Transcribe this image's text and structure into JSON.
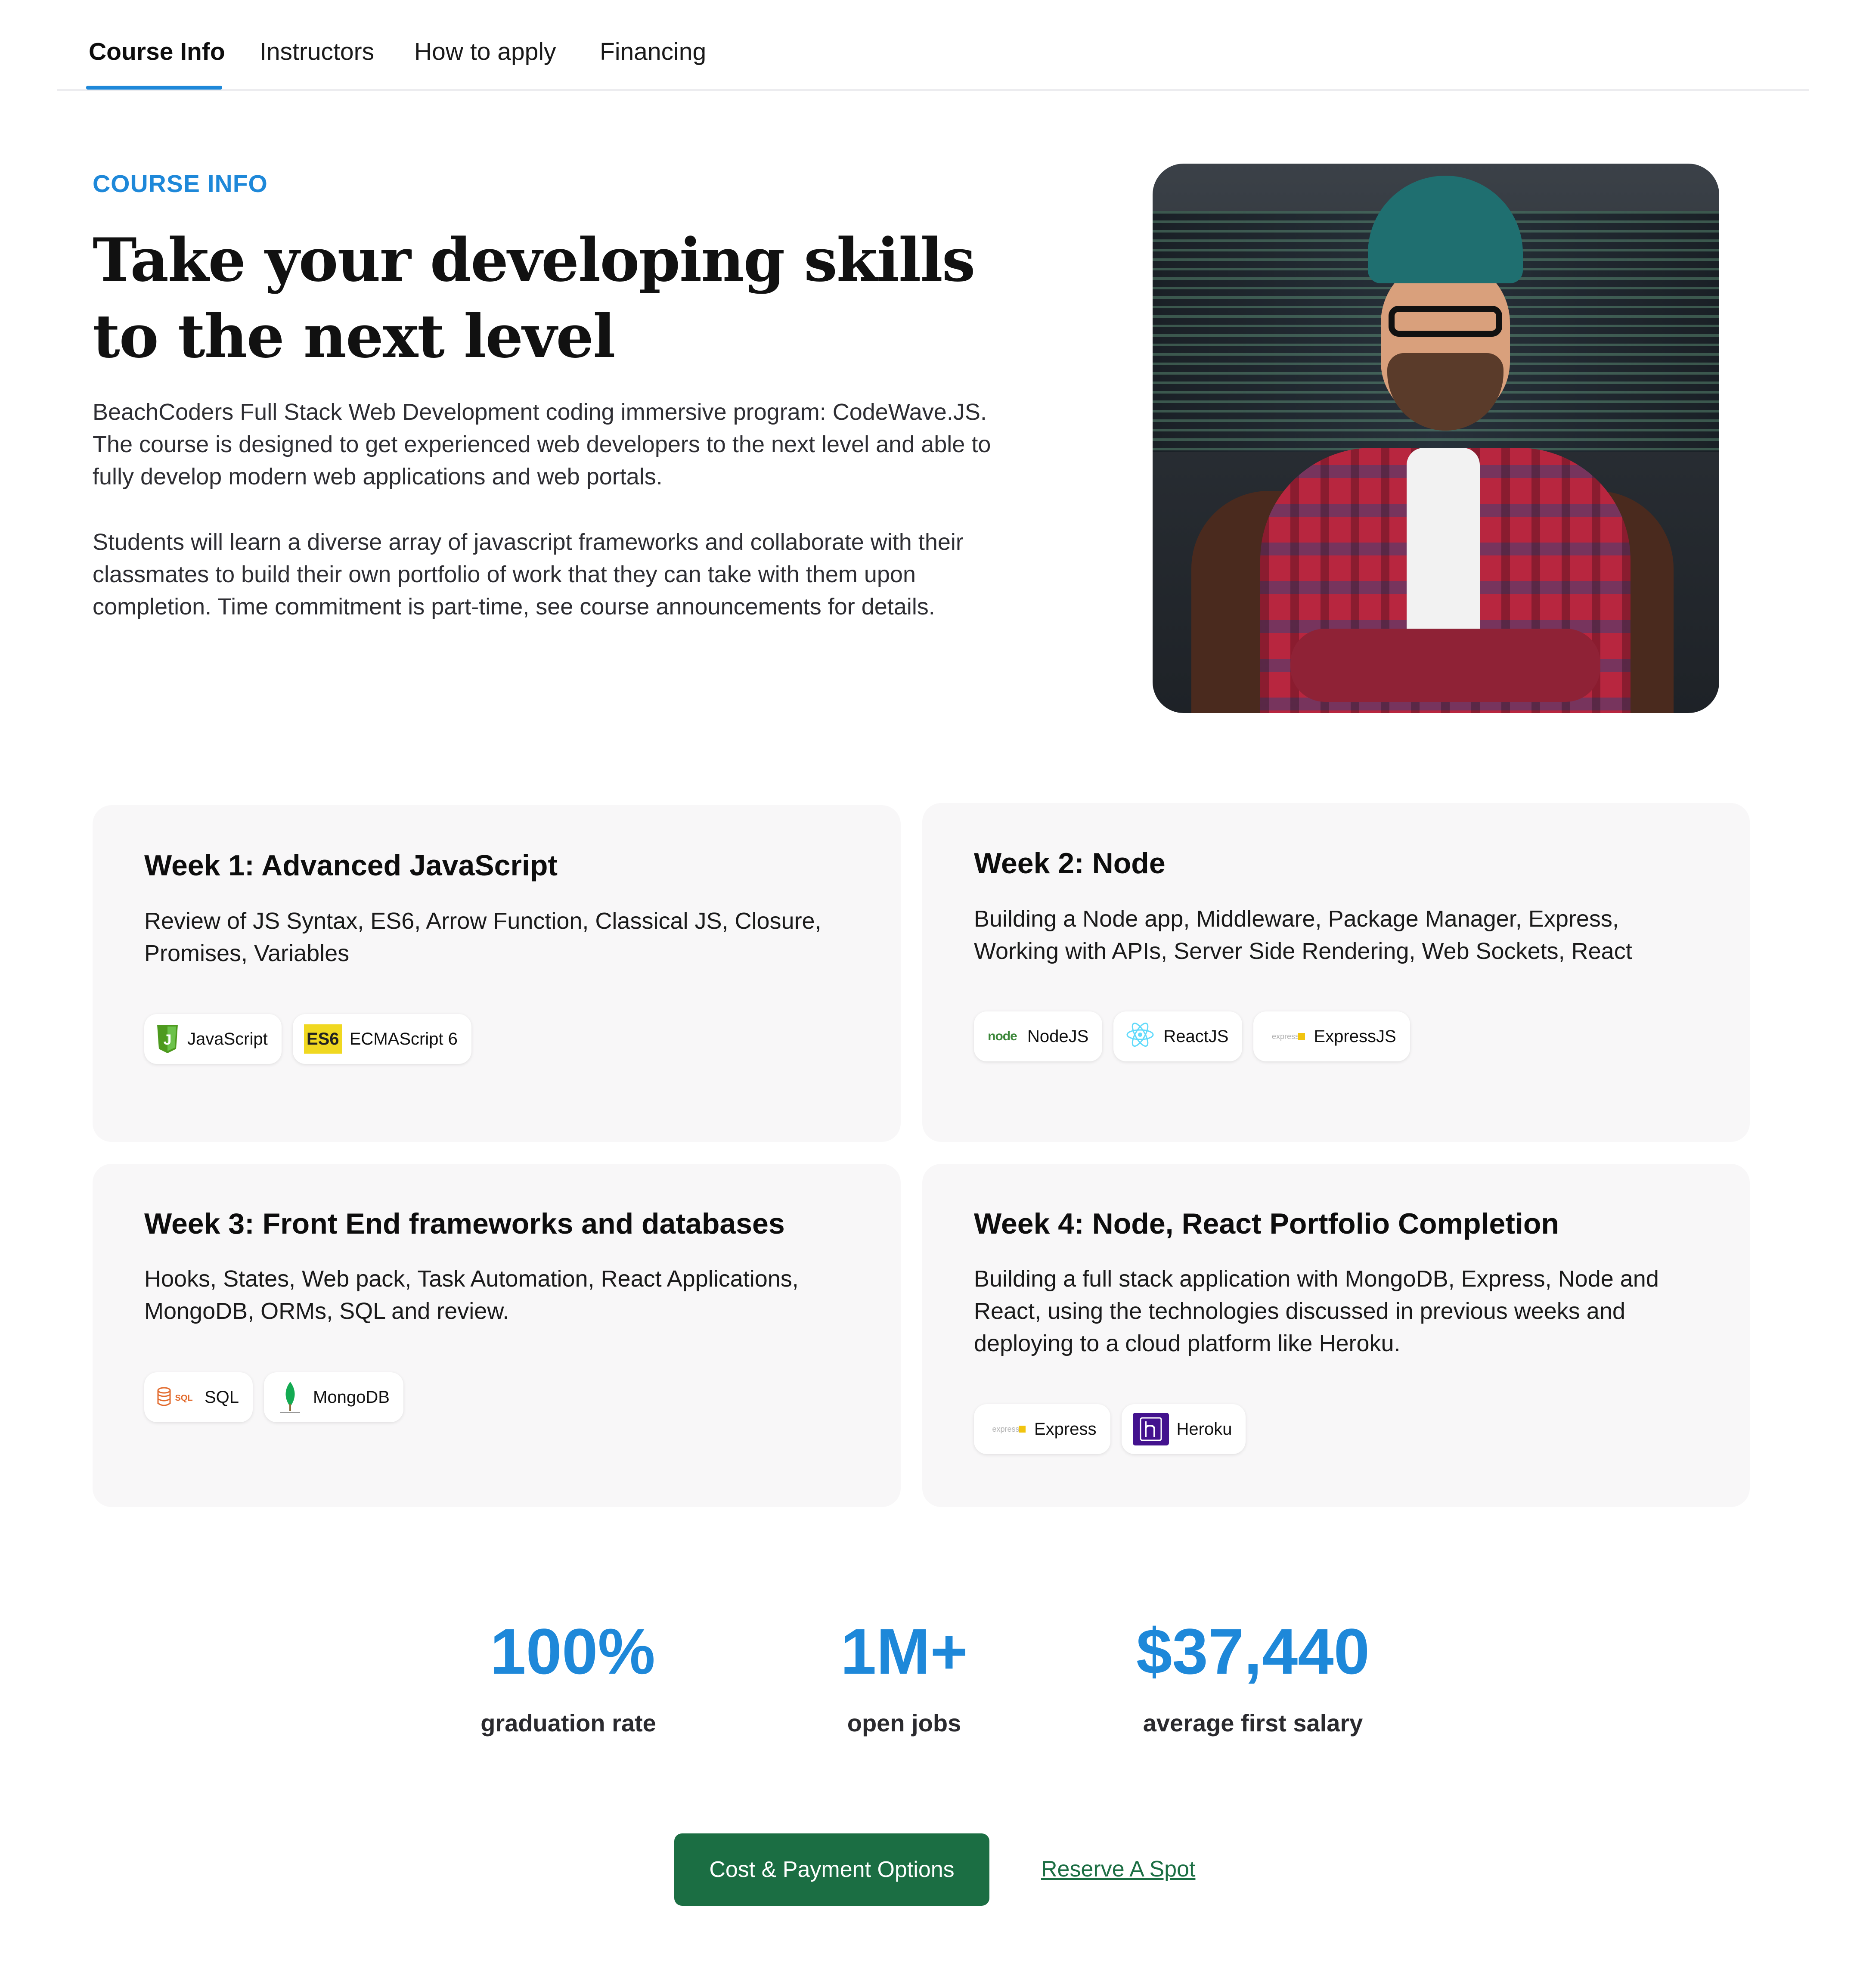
{
  "tabs": [
    {
      "label": "Course Info",
      "active": true
    },
    {
      "label": "Instructors",
      "active": false
    },
    {
      "label": "How to apply",
      "active": false
    },
    {
      "label": "Financing",
      "active": false
    }
  ],
  "hero": {
    "eyebrow": "COURSE INFO",
    "title": "Take your developing skills to the next level",
    "paragraph1": "BeachCoders Full Stack Web Development coding immersive program: CodeWave.JS. The course is designed to get experienced web developers to the next level and able to fully develop modern web applications and web portals.",
    "paragraph2": "Students will learn a diverse array of javascript frameworks and collaborate with their classmates to build their own portfolio of work that they can take with them upon completion. Time commitment is part-time, see course announcements for details.",
    "image_alt": "Smiling developer in beanie and plaid shirt in front of code screens"
  },
  "weeks": [
    {
      "title": "Week 1: Advanced JavaScript",
      "description": "Review of JS Syntax, ES6, Arrow Function, Classical JS, Closure, Promises, Variables",
      "chips": [
        {
          "label": "JavaScript",
          "icon": "javascript-logo-icon"
        },
        {
          "label": "ECMAScript 6",
          "icon": "es6-logo-icon",
          "logo_text": "ES6"
        }
      ]
    },
    {
      "title": "Week 2: Node",
      "description": "Building a Node app, Middleware, Package Manager, Express, Working with APIs, Server Side Rendering, Web Sockets, React",
      "chips": [
        {
          "label": "NodeJS",
          "icon": "nodejs-logo-icon",
          "logo_text": "node"
        },
        {
          "label": "ReactJS",
          "icon": "react-logo-icon"
        },
        {
          "label": "ExpressJS",
          "icon": "express-logo-icon",
          "logo_text": "express"
        }
      ]
    },
    {
      "title": "Week 3: Front End frameworks and databases",
      "description": "Hooks, States, Web pack, Task Automation, React Applications, MongoDB, ORMs, SQL and review.",
      "chips": [
        {
          "label": "SQL",
          "icon": "sql-database-icon",
          "logo_text": "SQL"
        },
        {
          "label": "MongoDB",
          "icon": "mongodb-leaf-icon"
        }
      ]
    },
    {
      "title": "Week 4: Node, React Portfolio Completion",
      "description": "Building a full stack application with MongoDB, Express, Node and React, using the technologies discussed in previous weeks and deploying to a cloud platform like Heroku.",
      "chips": [
        {
          "label": "Express",
          "icon": "express-logo-icon",
          "logo_text": "express"
        },
        {
          "label": "Heroku",
          "icon": "heroku-logo-icon"
        }
      ]
    }
  ],
  "stats": [
    {
      "value": "100%",
      "label": "graduation rate"
    },
    {
      "value": "1M+",
      "label": "open jobs"
    },
    {
      "value": "$37,440",
      "label": "average first salary"
    }
  ],
  "cta": {
    "primary_label": "Cost & Payment Options",
    "secondary_label": "Reserve A Spot"
  },
  "colors": {
    "accent_blue": "#1e88d9",
    "cta_green": "#1b6e43",
    "card_bg": "#f8f7f8"
  }
}
